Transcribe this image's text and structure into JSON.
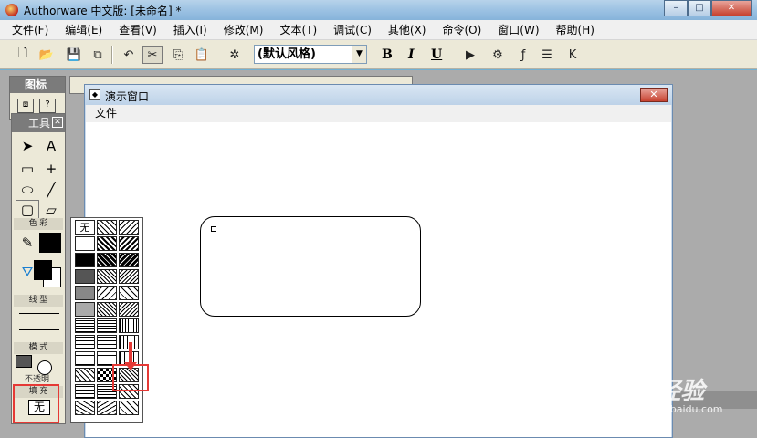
{
  "window": {
    "title": "Authorware 中文版: [未命名] *",
    "controls": {
      "minimize": "–",
      "maximize": "□",
      "close": "✕"
    }
  },
  "menubar": {
    "items": [
      "文件(F)",
      "编辑(E)",
      "查看(V)",
      "插入(I)",
      "修改(M)",
      "文本(T)",
      "调试(C)",
      "其他(X)",
      "命令(O)",
      "窗口(W)",
      "帮助(H)"
    ]
  },
  "toolbar": {
    "style_select": "(默认风格)",
    "bold": "B",
    "italic": "I",
    "underline": "U"
  },
  "icons_panel": {
    "title": "图标"
  },
  "tools_panel": {
    "title": "工具",
    "sections": {
      "color": "色 彩",
      "line": "线 型",
      "mode": "模 式",
      "mode_value": "不透明",
      "fill": "填 充"
    },
    "fill_value": "无"
  },
  "pattern_popup": {
    "none_label": "无"
  },
  "presentation": {
    "title": "演示窗口",
    "menu_file": "文件",
    "close": "✕"
  },
  "watermark": {
    "text": "Baidu经验",
    "subtext": "jingyan.baidu.com"
  },
  "colors": {
    "highlight": "#e53935",
    "titlebar": "#9cc2e3"
  }
}
